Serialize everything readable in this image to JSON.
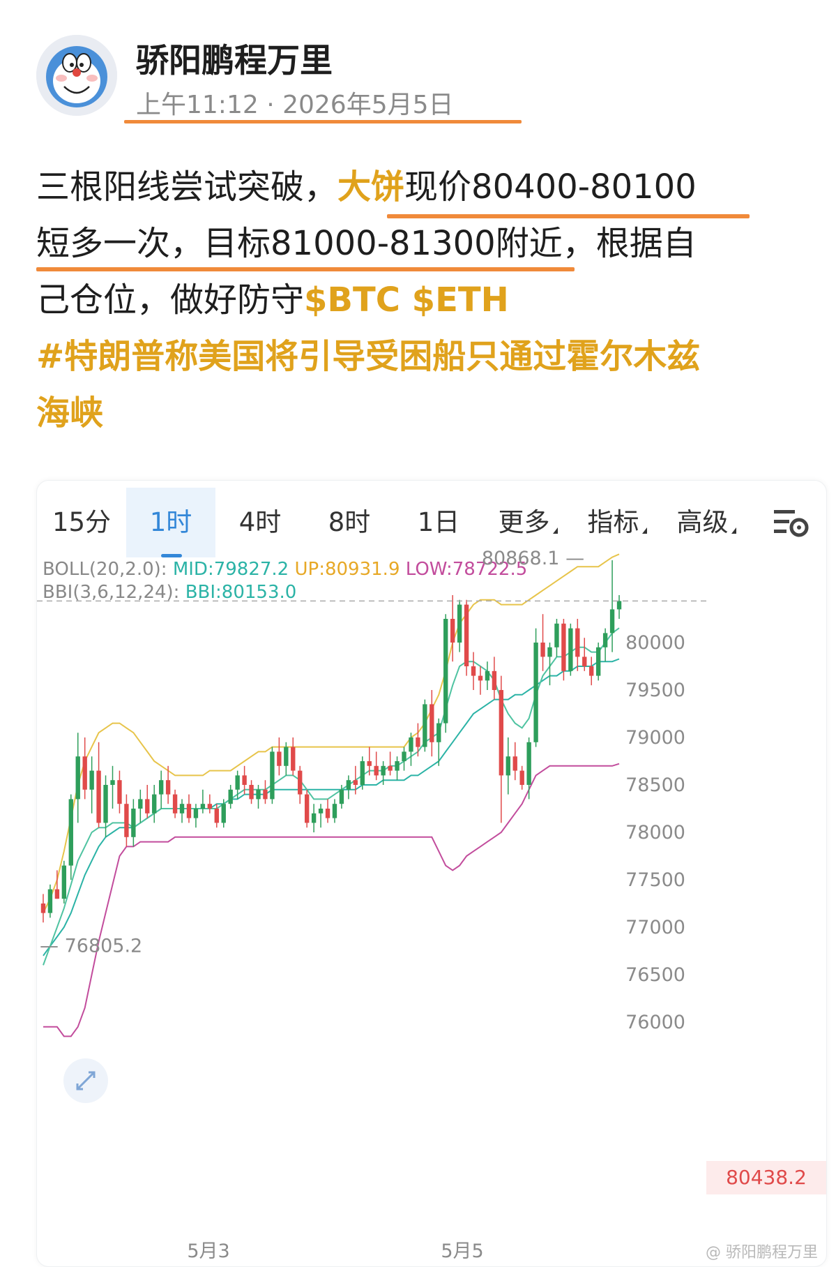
{
  "post": {
    "author": "骄阳鹏程万里",
    "timestamp": "上午11:12 · 2026年5月5日",
    "line1_pre": "三根阳线尝试突破，",
    "line1_tag": "大饼",
    "line1_post": "现价80400-80100",
    "line2": "短多一次，目标81000-81300附近，根据自",
    "line3_pre": "己仓位，做好防守",
    "line3_tags": "$BTC $ETH",
    "hashtag_line1": "#特朗普称美国将引导受困船只通过霍尔木兹",
    "hashtag_line2": "海峡"
  },
  "chart": {
    "tabs": [
      {
        "label": "15分",
        "active": false
      },
      {
        "label": "1时",
        "active": true
      },
      {
        "label": "4时",
        "active": false
      },
      {
        "label": "8时",
        "active": false
      },
      {
        "label": "1日",
        "active": false
      },
      {
        "label": "更多",
        "active": false
      },
      {
        "label": "指标",
        "active": false
      },
      {
        "label": "高级",
        "active": false
      }
    ],
    "settings_icon": "chart-settings-icon",
    "indicators": {
      "boll_name": "BOLL(20,2.0):",
      "boll_mid": "MID:79827.2",
      "boll_up": "UP:80931.9",
      "boll_low": "LOW:78722.5",
      "bbi_name": "BBI(3,6,12,24):",
      "bbi_value": "BBI:80153.0"
    },
    "current_price_label": "80438.2",
    "high_annotation": "80868.1",
    "low_annotation": "76805.2",
    "watermark": "@ 骄阳鹏程万里",
    "colors": {
      "up": "#2e9e5b",
      "down": "#e04a4a",
      "boll_up": "#e7c44a",
      "boll_low": "#c24c9c",
      "mid": "#2bb3a6",
      "bbi": "#4fc3a1"
    }
  },
  "chart_data": {
    "type": "candlestick",
    "title": "",
    "x_tick_labels": [
      "5月3",
      "5月5"
    ],
    "y_ticks": [
      76000,
      76500,
      77000,
      77500,
      78000,
      78500,
      79000,
      79500,
      80000
    ],
    "ylim": [
      75900,
      81300
    ],
    "grid": false,
    "current_price": 80438.2,
    "annotations": [
      {
        "text": "80868.1",
        "value": 80868.1
      },
      {
        "text": "76805.2",
        "value": 76805.2
      }
    ],
    "candles": [
      [
        77250,
        77350,
        77050,
        77150
      ],
      [
        77150,
        77450,
        77100,
        77400
      ],
      [
        77400,
        77600,
        77300,
        77300
      ],
      [
        77300,
        77700,
        77250,
        77650
      ],
      [
        77650,
        78400,
        77500,
        78350
      ],
      [
        78350,
        79050,
        78100,
        78800
      ],
      [
        78800,
        79000,
        78350,
        78450
      ],
      [
        78450,
        78800,
        78200,
        78650
      ],
      [
        78650,
        78950,
        78050,
        78100
      ],
      [
        78100,
        78600,
        77950,
        78500
      ],
      [
        78500,
        78700,
        78250,
        78550
      ],
      [
        78550,
        78650,
        78200,
        78300
      ],
      [
        78300,
        78400,
        77850,
        77950
      ],
      [
        77950,
        78350,
        77850,
        78250
      ],
      [
        78250,
        78450,
        78100,
        78350
      ],
      [
        78350,
        78500,
        78150,
        78200
      ],
      [
        78200,
        78500,
        78100,
        78400
      ],
      [
        78400,
        78650,
        78250,
        78550
      ],
      [
        78550,
        78700,
        78300,
        78400
      ],
      [
        78400,
        78450,
        78150,
        78200
      ],
      [
        78200,
        78350,
        78100,
        78300
      ],
      [
        78300,
        78400,
        78100,
        78150
      ],
      [
        78150,
        78300,
        78050,
        78250
      ],
      [
        78250,
        78450,
        78200,
        78300
      ],
      [
        78300,
        78400,
        78200,
        78250
      ],
      [
        78250,
        78300,
        78050,
        78100
      ],
      [
        78100,
        78350,
        78050,
        78300
      ],
      [
        78300,
        78500,
        78250,
        78450
      ],
      [
        78450,
        78650,
        78350,
        78600
      ],
      [
        78600,
        78700,
        78400,
        78500
      ],
      [
        78500,
        78550,
        78300,
        78350
      ],
      [
        78350,
        78500,
        78250,
        78450
      ],
      [
        78450,
        78550,
        78300,
        78350
      ],
      [
        78350,
        78900,
        78300,
        78850
      ],
      [
        78850,
        79000,
        78600,
        78700
      ],
      [
        78700,
        78950,
        78600,
        78900
      ],
      [
        78900,
        79000,
        78600,
        78650
      ],
      [
        78650,
        78700,
        78300,
        78400
      ],
      [
        78400,
        78450,
        78050,
        78100
      ],
      [
        78100,
        78300,
        78000,
        78200
      ],
      [
        78200,
        78300,
        78050,
        78250
      ],
      [
        78250,
        78350,
        78100,
        78150
      ],
      [
        78150,
        78350,
        78100,
        78300
      ],
      [
        78300,
        78500,
        78250,
        78450
      ],
      [
        78450,
        78600,
        78350,
        78550
      ],
      [
        78550,
        78700,
        78400,
        78500
      ],
      [
        78500,
        78800,
        78450,
        78750
      ],
      [
        78750,
        78900,
        78600,
        78700
      ],
      [
        78700,
        78850,
        78550,
        78600
      ],
      [
        78600,
        78750,
        78500,
        78700
      ],
      [
        78700,
        78850,
        78600,
        78650
      ],
      [
        78650,
        78800,
        78550,
        78750
      ],
      [
        78750,
        78900,
        78650,
        78850
      ],
      [
        78850,
        79050,
        78700,
        79000
      ],
      [
        79000,
        79150,
        78800,
        78900
      ],
      [
        78900,
        79400,
        78850,
        79350
      ],
      [
        79350,
        79500,
        78800,
        78950
      ],
      [
        78950,
        79200,
        78700,
        79150
      ],
      [
        79150,
        80300,
        79050,
        80250
      ],
      [
        80250,
        80500,
        79800,
        80000
      ],
      [
        80000,
        80450,
        79900,
        80400
      ],
      [
        80400,
        80450,
        79650,
        79750
      ],
      [
        79750,
        79900,
        79500,
        79650
      ],
      [
        79650,
        79750,
        79450,
        79600
      ],
      [
        79600,
        79800,
        79500,
        79700
      ],
      [
        79700,
        79850,
        79400,
        79500
      ],
      [
        79500,
        79650,
        78100,
        78600
      ],
      [
        78600,
        79000,
        78400,
        78800
      ],
      [
        78800,
        78950,
        78550,
        78650
      ],
      [
        78650,
        78700,
        78450,
        78500
      ],
      [
        78500,
        79000,
        78350,
        78950
      ],
      [
        78950,
        80150,
        78900,
        80000
      ],
      [
        80000,
        80300,
        79700,
        79850
      ],
      [
        79850,
        80000,
        79550,
        79950
      ],
      [
        79950,
        80250,
        79850,
        80200
      ],
      [
        80200,
        80250,
        79600,
        79700
      ],
      [
        79700,
        80200,
        79650,
        80150
      ],
      [
        80150,
        80250,
        79700,
        79850
      ],
      [
        79850,
        80050,
        79700,
        79750
      ],
      [
        79750,
        79850,
        79550,
        79650
      ],
      [
        79650,
        80000,
        79600,
        79950
      ],
      [
        79950,
        80150,
        79800,
        80100
      ],
      [
        80100,
        80868.1,
        79900,
        80350
      ],
      [
        80350,
        80500,
        80250,
        80438.2
      ]
    ],
    "series": [
      {
        "name": "UP",
        "values": [
          77150,
          77300,
          77500,
          77800,
          78150,
          78500,
          78750,
          78900,
          79050,
          79100,
          79150,
          79150,
          79100,
          79050,
          78950,
          78850,
          78750,
          78700,
          78650,
          78600,
          78600,
          78600,
          78600,
          78600,
          78650,
          78650,
          78650,
          78650,
          78700,
          78750,
          78800,
          78850,
          78850,
          78900,
          78900,
          78900,
          78900,
          78900,
          78900,
          78900,
          78900,
          78900,
          78900,
          78900,
          78900,
          78900,
          78900,
          78900,
          78900,
          78900,
          78900,
          78900,
          78900,
          79000,
          79050,
          79150,
          79300,
          79450,
          79700,
          80000,
          80200,
          80300,
          80400,
          80450,
          80450,
          80450,
          80400,
          80400,
          80400,
          80400,
          80450,
          80500,
          80550,
          80600,
          80650,
          80700,
          80750,
          80800,
          80800,
          80800,
          80800,
          80850,
          80900,
          80931.9
        ]
      },
      {
        "name": "MID",
        "values": [
          76700,
          76800,
          76900,
          77000,
          77150,
          77350,
          77550,
          77700,
          77850,
          77950,
          78000,
          78050,
          78050,
          78050,
          78100,
          78150,
          78200,
          78250,
          78250,
          78250,
          78250,
          78250,
          78250,
          78250,
          78250,
          78300,
          78300,
          78350,
          78350,
          78400,
          78400,
          78400,
          78400,
          78450,
          78450,
          78450,
          78450,
          78450,
          78450,
          78450,
          78450,
          78450,
          78450,
          78450,
          78450,
          78450,
          78500,
          78500,
          78500,
          78550,
          78550,
          78550,
          78550,
          78600,
          78600,
          78650,
          78700,
          78750,
          78850,
          78950,
          79050,
          79150,
          79250,
          79300,
          79350,
          79400,
          79400,
          79400,
          79450,
          79450,
          79500,
          79550,
          79600,
          79650,
          79650,
          79700,
          79700,
          79750,
          79750,
          79750,
          79800,
          79800,
          79800,
          79827.2
        ]
      },
      {
        "name": "LOW",
        "values": [
          75950,
          75950,
          75950,
          75850,
          75850,
          75950,
          76150,
          76500,
          76850,
          77150,
          77450,
          77750,
          77850,
          77850,
          77900,
          77900,
          77900,
          77900,
          77900,
          77950,
          77950,
          77950,
          77950,
          77950,
          77950,
          77950,
          77950,
          77950,
          77950,
          77950,
          77950,
          77950,
          77950,
          77950,
          77950,
          77950,
          77950,
          77950,
          77950,
          77950,
          77950,
          77950,
          77950,
          77950,
          77950,
          77950,
          77950,
          77950,
          77950,
          77950,
          77950,
          77950,
          77950,
          77950,
          77950,
          77950,
          77950,
          77800,
          77650,
          77600,
          77650,
          77750,
          77800,
          77850,
          77900,
          77950,
          78000,
          78100,
          78200,
          78300,
          78450,
          78600,
          78650,
          78700,
          78700,
          78700,
          78700,
          78700,
          78700,
          78700,
          78700,
          78700,
          78700,
          78722.5
        ]
      },
      {
        "name": "BBI",
        "values": [
          76600,
          76800,
          77000,
          77200,
          77450,
          77700,
          77850,
          78000,
          78050,
          78050,
          78100,
          78100,
          78100,
          78050,
          78100,
          78150,
          78200,
          78250,
          78250,
          78250,
          78250,
          78250,
          78250,
          78250,
          78250,
          78250,
          78300,
          78350,
          78400,
          78450,
          78450,
          78450,
          78450,
          78500,
          78550,
          78600,
          78600,
          78550,
          78450,
          78350,
          78350,
          78350,
          78400,
          78450,
          78500,
          78550,
          78600,
          78650,
          78650,
          78650,
          78700,
          78700,
          78750,
          78800,
          78850,
          78950,
          79000,
          79050,
          79300,
          79550,
          79750,
          79800,
          79800,
          79750,
          79700,
          79600,
          79400,
          79250,
          79150,
          79100,
          79200,
          79450,
          79650,
          79750,
          79850,
          79850,
          79900,
          79950,
          79950,
          79900,
          79900,
          80000,
          80100,
          80153
        ]
      }
    ]
  }
}
